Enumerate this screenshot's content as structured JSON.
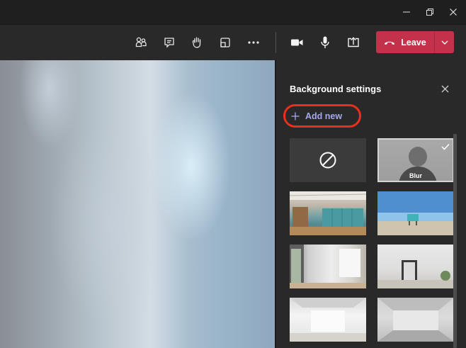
{
  "window": {
    "minimize_icon": "minimize-icon",
    "restore_icon": "restore-icon",
    "close_icon": "close-icon"
  },
  "toolbar": {
    "buttons": [
      {
        "name": "participants",
        "icon": "people-icon"
      },
      {
        "name": "chat",
        "icon": "chat-icon"
      },
      {
        "name": "raise-hand",
        "icon": "hand-icon"
      },
      {
        "name": "rooms",
        "icon": "rooms-icon"
      },
      {
        "name": "more",
        "icon": "more-icon"
      },
      {
        "name": "camera",
        "icon": "camera-icon"
      },
      {
        "name": "mic",
        "icon": "microphone-icon"
      },
      {
        "name": "share",
        "icon": "share-icon"
      }
    ],
    "leave_label": "Leave",
    "leave_color": "#c4314b"
  },
  "panel": {
    "title": "Background settings",
    "add_new_label": "Add new",
    "add_new_highlight_color": "#e8301c",
    "accent_color": "#a7a7ef",
    "backgrounds": [
      {
        "name": "none",
        "label": ""
      },
      {
        "name": "blur",
        "label": "Blur",
        "selected": true
      },
      {
        "name": "office",
        "label": ""
      },
      {
        "name": "beach",
        "label": ""
      },
      {
        "name": "room-1",
        "label": ""
      },
      {
        "name": "room-2",
        "label": ""
      },
      {
        "name": "room-3",
        "label": ""
      },
      {
        "name": "room-4",
        "label": ""
      }
    ]
  }
}
